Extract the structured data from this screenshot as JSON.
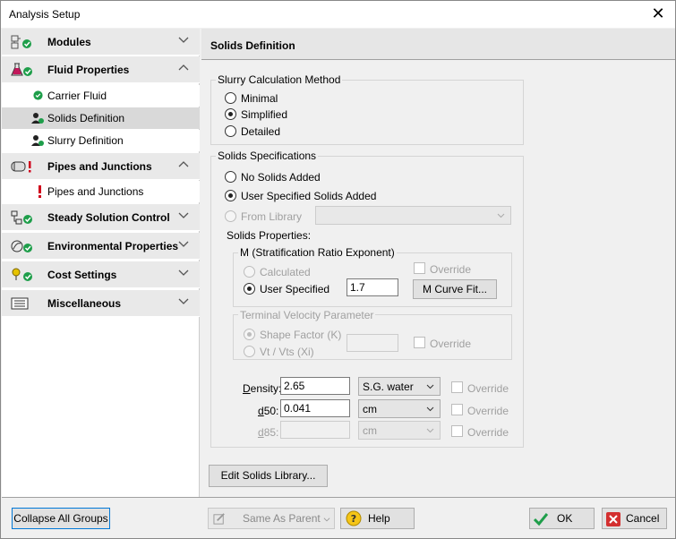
{
  "window": {
    "title": "Analysis Setup",
    "close_glyph": "✕"
  },
  "sidebar": {
    "groups": [
      {
        "label": "Modules",
        "icon": "modules-icon",
        "status": "ok"
      },
      {
        "label": "Fluid Properties",
        "icon": "fluid-flask-icon",
        "status": "ok"
      },
      {
        "label": "Pipes and Junctions",
        "icon": "pipe-icon",
        "status": "error"
      },
      {
        "label": "Steady Solution Control",
        "icon": "solution-control-icon",
        "status": "ok"
      },
      {
        "label": "Environmental Properties",
        "icon": "environment-icon",
        "status": "ok"
      },
      {
        "label": "Cost Settings",
        "icon": "cost-icon",
        "status": "ok"
      },
      {
        "label": "Miscellaneous",
        "icon": "misc-icon",
        "status": "none"
      }
    ],
    "fluid_items": [
      {
        "label": "Carrier Fluid"
      },
      {
        "label": "Solids Definition"
      },
      {
        "label": "Slurry Definition"
      }
    ],
    "pipes_items": [
      {
        "label": "Pipes and Junctions"
      }
    ]
  },
  "main": {
    "title": "Solids Definition",
    "slurry_method": {
      "legend": "Slurry Calculation Method",
      "options": [
        "Minimal",
        "Simplified",
        "Detailed"
      ],
      "selected": "Simplified"
    },
    "solids_specs": {
      "legend": "Solids Specifications",
      "no_solids": "No Solids Added",
      "user_specified": "User Specified Solids Added",
      "from_library": "From Library",
      "library_value": "",
      "solids_properties": "Solids Properties:",
      "m_group": {
        "legend": "M (Stratification Ratio Exponent)",
        "calculated": "Calculated",
        "user_specified": "User Specified",
        "override": "Override",
        "value": "1.7",
        "curve_button": "M Curve Fit..."
      },
      "terminal": {
        "legend": "Terminal Velocity Parameter",
        "shape_factor": "Shape Factor (K)",
        "vt_vts": "Vt / Vts (Xi)",
        "value": "",
        "override": "Override"
      },
      "density": {
        "label": "Density:",
        "value": "2.65",
        "unit": "S.G. water",
        "override": "Override"
      },
      "d50": {
        "label": "d50:",
        "value": "0.041",
        "unit": "cm",
        "override": "Override"
      },
      "d85": {
        "label": "d85:",
        "value": "",
        "unit": "cm",
        "override": "Override"
      }
    },
    "edit_library_button": "Edit Solids Library..."
  },
  "footer": {
    "collapse_button": "Collapse All Groups",
    "same_as_parent": "Same As Parent",
    "help": "Help",
    "ok": "OK",
    "cancel": "Cancel"
  },
  "colors": {
    "ok_green": "#1e9e4a",
    "error_red": "#d0021b",
    "flask_magenta": "#c2185b",
    "cancel_red": "#d32f2f"
  }
}
